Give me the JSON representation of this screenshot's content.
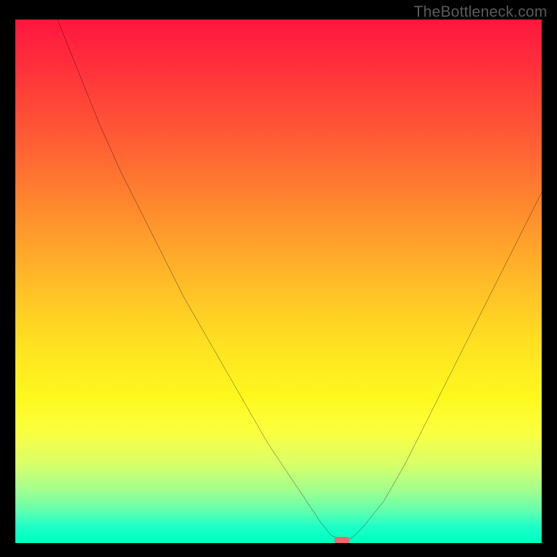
{
  "attribution": "TheBottleneck.com",
  "colors": {
    "page_bg": "#000000",
    "marker": "#e86a6a",
    "curve": "#000000",
    "gradient_stops": [
      {
        "pct": 0,
        "hex": "#ff163e"
      },
      {
        "pct": 8,
        "hex": "#ff2d3c"
      },
      {
        "pct": 22,
        "hex": "#ff5935"
      },
      {
        "pct": 36,
        "hex": "#ff8a2e"
      },
      {
        "pct": 50,
        "hex": "#ffbb28"
      },
      {
        "pct": 62,
        "hex": "#ffe122"
      },
      {
        "pct": 72,
        "hex": "#fff81e"
      },
      {
        "pct": 79,
        "hex": "#faff40"
      },
      {
        "pct": 85,
        "hex": "#d8ff6a"
      },
      {
        "pct": 90,
        "hex": "#a0ff90"
      },
      {
        "pct": 94,
        "hex": "#5effb0"
      },
      {
        "pct": 97,
        "hex": "#1affc8"
      },
      {
        "pct": 100,
        "hex": "#00ffbe"
      }
    ]
  },
  "chart_data": {
    "type": "line",
    "title": "",
    "xlabel": "",
    "ylabel": "",
    "xlim": [
      0,
      100
    ],
    "ylim": [
      0,
      100
    ],
    "optimal_x": 62,
    "marker": {
      "x": 62,
      "y": 99.5
    },
    "series": [
      {
        "name": "bottleneck-curve",
        "x": [
          8,
          12,
          16,
          20,
          24,
          28,
          32,
          36,
          40,
          44,
          48,
          52,
          56,
          58,
          60,
          62,
          64,
          66,
          70,
          74,
          78,
          82,
          86,
          90,
          94,
          98,
          100
        ],
        "y": [
          0,
          10,
          20,
          29,
          37,
          45,
          53,
          60,
          67,
          74,
          81,
          87,
          93,
          96,
          98.5,
          99.5,
          99,
          97,
          92,
          85,
          77,
          69,
          61,
          53,
          45,
          37,
          33
        ]
      }
    ]
  }
}
